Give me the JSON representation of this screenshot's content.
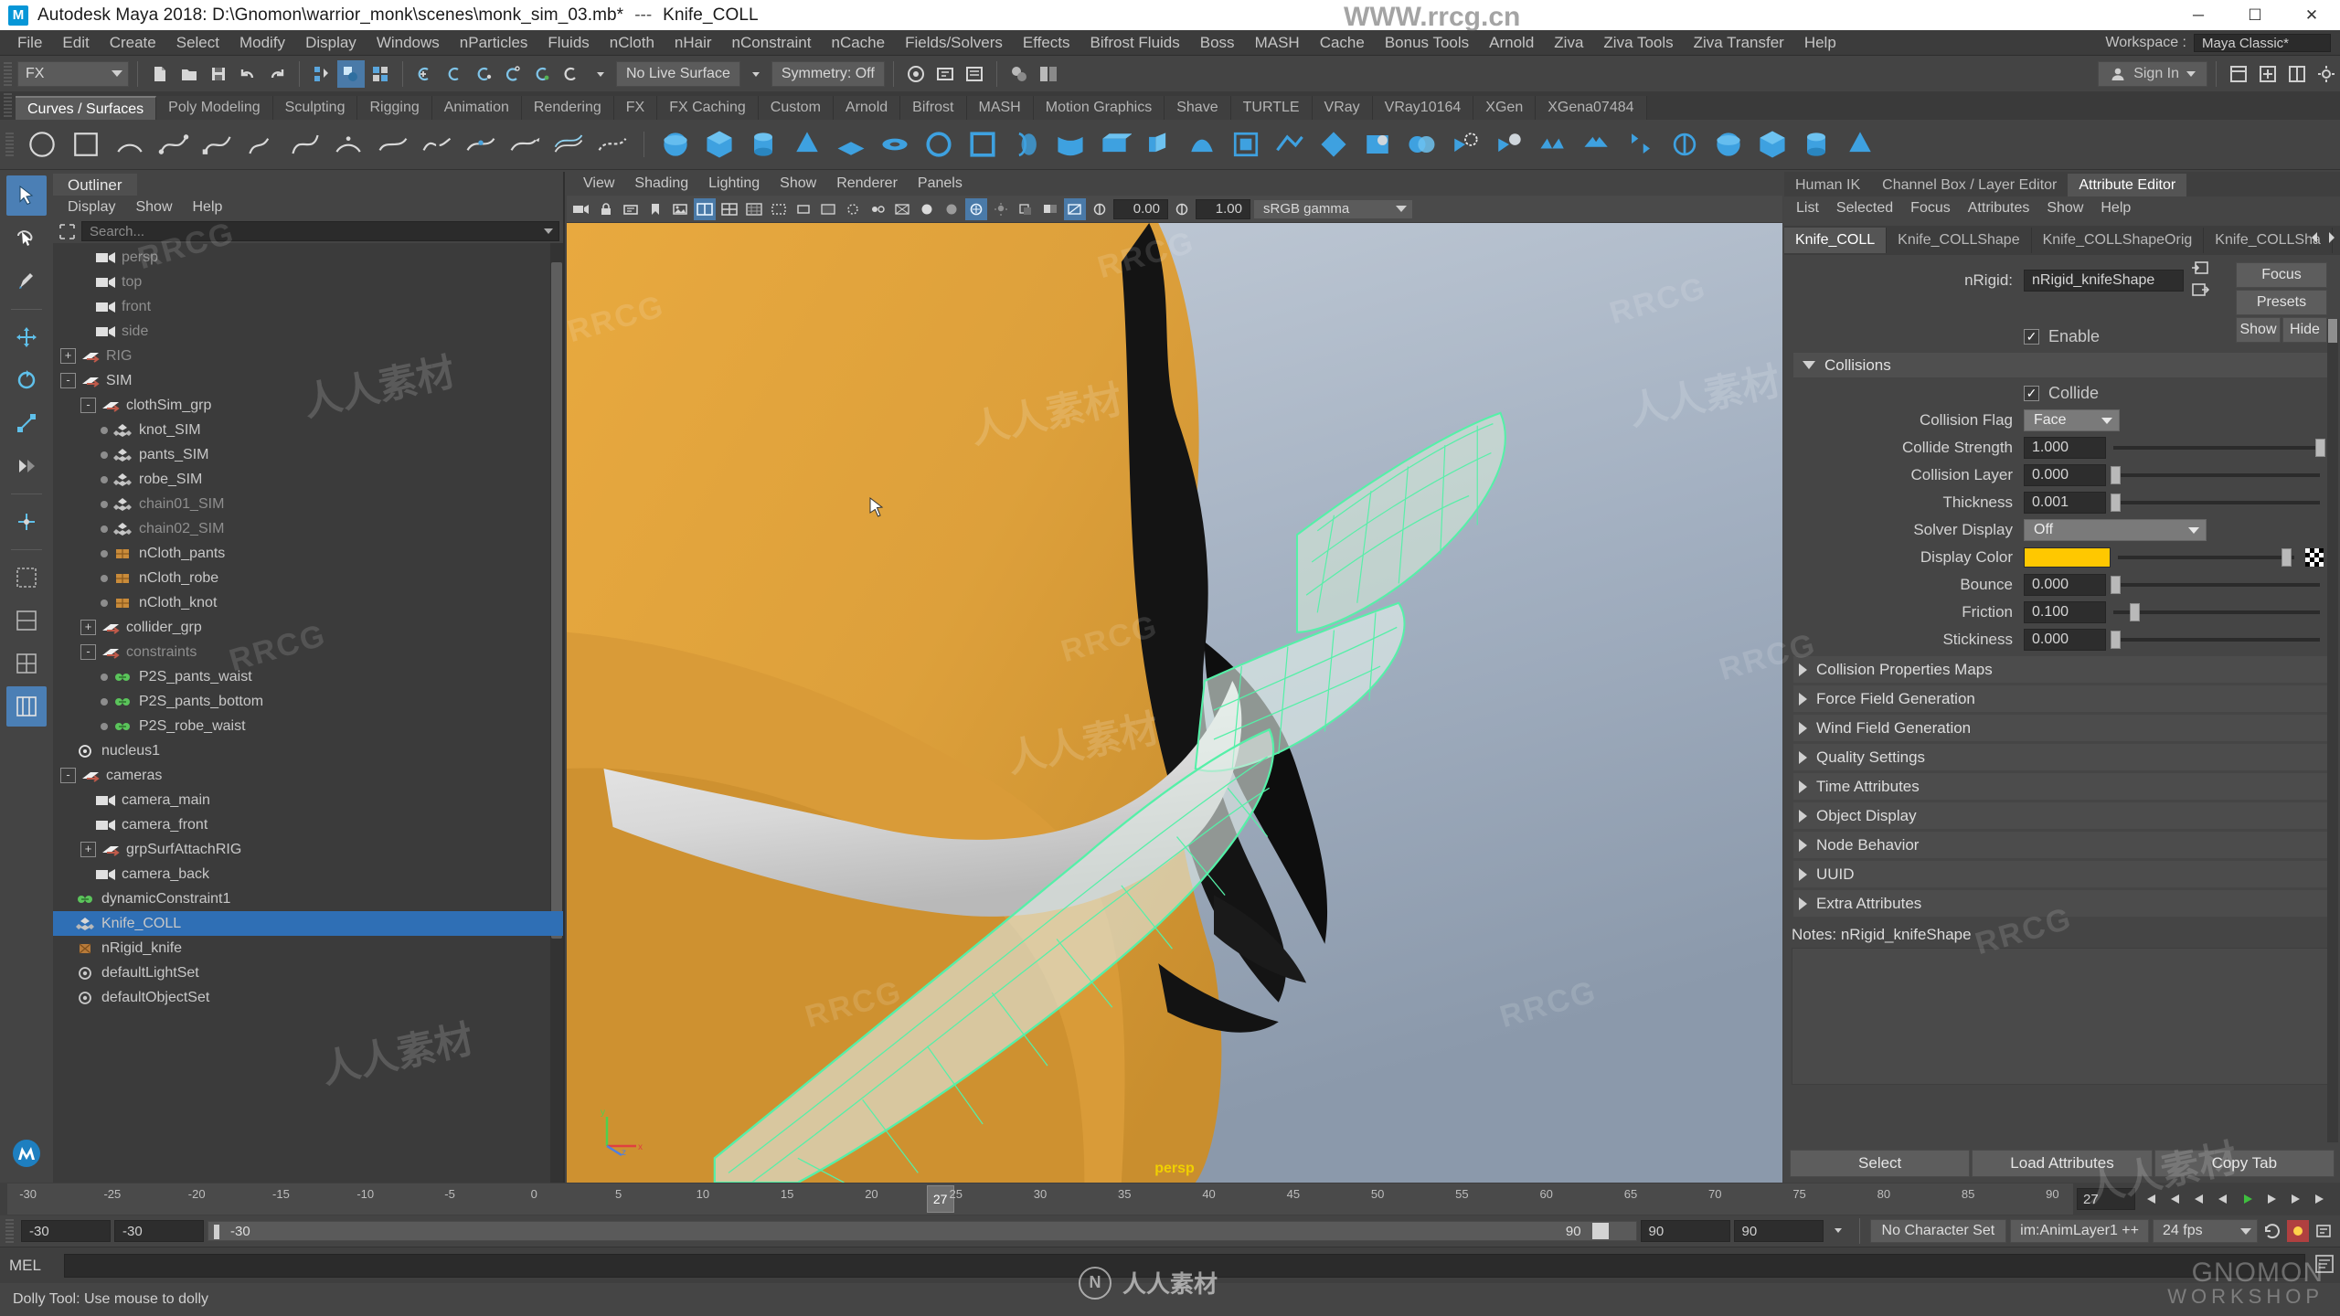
{
  "titlebar": {
    "logo": "M",
    "title": "Autodesk Maya 2018: D:\\Gnomon\\warrior_monk\\scenes\\monk_sim_03.mb*",
    "separator": "---",
    "object": "Knife_COLL",
    "minimize": "─",
    "maximize": "☐",
    "close": "✕"
  },
  "menubar": {
    "items": [
      "File",
      "Edit",
      "Create",
      "Select",
      "Modify",
      "Display",
      "Windows",
      "nParticles",
      "Fluids",
      "nCloth",
      "nHair",
      "nConstraint",
      "nCache",
      "Fields/Solvers",
      "Effects",
      "Bifrost Fluids",
      "Boss",
      "MASH",
      "Cache",
      "Bonus Tools",
      "Arnold",
      "Ziva",
      "Ziva Tools",
      "Ziva Transfer",
      "Help"
    ],
    "workspace_label": "Workspace :",
    "workspace_value": "Maya Classic*"
  },
  "statusline": {
    "mode": "FX",
    "live_surface": "No Live Surface",
    "symmetry": "Symmetry: Off",
    "signin": "Sign In",
    "icons": [
      "new-scene-icon",
      "open-scene-icon",
      "save-scene-icon",
      "undo-icon",
      "redo-icon",
      "select-by-hierarchy-icon",
      "select-by-object-icon",
      "select-by-component-icon",
      "snap-to-grid-icon",
      "snap-to-curve-icon",
      "snap-to-point-icon",
      "snap-to-projected-center-icon",
      "snap-to-view-plane-icon",
      "make-live-icon",
      "render-current-frame-icon",
      "ipr-render-icon",
      "render-settings-icon",
      "hypershade-icon",
      "show-hide-editors-icon"
    ]
  },
  "shelf": {
    "tabs": [
      "Curves / Surfaces",
      "Poly Modeling",
      "Sculpting",
      "Rigging",
      "Animation",
      "Rendering",
      "FX",
      "FX Caching",
      "Custom",
      "Arnold",
      "Bifrost",
      "MASH",
      "Motion Graphics",
      "Shave",
      "TURTLE",
      "VRay",
      "VRay10164",
      "XGen",
      "XGena07484"
    ],
    "active_tab": "Curves / Surfaces",
    "icons": [
      "nurbs-circle-icon",
      "nurbs-square-icon",
      "nurbs-arc-icon",
      "ep-curve-icon",
      "cv-curve-icon",
      "pencil-curve-icon",
      "bezier-curve-icon",
      "three-point-arc-icon",
      "attach-curve-icon",
      "detach-curve-icon",
      "insert-knot-icon",
      "extend-curve-icon",
      "offset-curve-icon",
      "rebuild-curve-icon",
      "sphere-icon",
      "cube-icon",
      "cylinder-icon",
      "cone-icon",
      "plane-icon",
      "torus-icon",
      "circle-prim-icon",
      "square-prim-icon",
      "revolve-icon",
      "loft-icon",
      "planar-icon",
      "extrude-icon",
      "birail-icon",
      "boundary-icon",
      "square-surface-icon",
      "bevel-icon",
      "bevel-plus-icon",
      "intersect-icon",
      "project-curve-icon",
      "trim-icon",
      "untrim-icon",
      "booleans-union-icon",
      "booleans-subtract-icon",
      "attach-surfaces-icon",
      "detach-surfaces-icon",
      "align-surfaces-icon",
      "sculpt-geometry-icon",
      "surface-editing-icon"
    ]
  },
  "toolbox": {
    "tools": [
      "select-tool",
      "lasso-select-tool",
      "paint-select-tool",
      "move-tool",
      "rotate-tool",
      "scale-tool",
      "last-tool-used",
      "show-manipulator-tool",
      "four-view-layout",
      "persp-outliner-layout",
      "persp-graph-layout",
      "hypershade-persp-layout"
    ]
  },
  "outliner": {
    "tab": "Outliner",
    "menus": [
      "Display",
      "Show",
      "Help"
    ],
    "search_placeholder": "Search...",
    "tree": [
      {
        "label": "persp",
        "depth": 1,
        "icon": "camera-icon",
        "expander": "",
        "dim": true
      },
      {
        "label": "top",
        "depth": 1,
        "icon": "camera-icon",
        "expander": "",
        "dim": true
      },
      {
        "label": "front",
        "depth": 1,
        "icon": "camera-icon",
        "expander": "",
        "dim": true
      },
      {
        "label": "side",
        "depth": 1,
        "icon": "camera-icon",
        "expander": "",
        "dim": true
      },
      {
        "label": "RIG",
        "depth": 0,
        "icon": "transform-icon",
        "expander": "+",
        "dim": true
      },
      {
        "label": "SIM",
        "depth": 0,
        "icon": "transform-icon",
        "expander": "-",
        "dim": false
      },
      {
        "label": "clothSim_grp",
        "depth": 1,
        "icon": "transform-icon",
        "expander": "-",
        "dim": false
      },
      {
        "label": "knot_SIM",
        "depth": 2,
        "icon": "mesh-icon",
        "expander": "",
        "dim": false
      },
      {
        "label": "pants_SIM",
        "depth": 2,
        "icon": "mesh-icon",
        "expander": "",
        "dim": false
      },
      {
        "label": "robe_SIM",
        "depth": 2,
        "icon": "mesh-icon",
        "expander": "",
        "dim": false
      },
      {
        "label": "chain01_SIM",
        "depth": 2,
        "icon": "mesh-icon",
        "expander": "",
        "dim": true
      },
      {
        "label": "chain02_SIM",
        "depth": 2,
        "icon": "mesh-icon",
        "expander": "",
        "dim": true
      },
      {
        "label": "nCloth_pants",
        "depth": 2,
        "icon": "ncloth-icon",
        "expander": "",
        "dim": false
      },
      {
        "label": "nCloth_robe",
        "depth": 2,
        "icon": "ncloth-icon",
        "expander": "",
        "dim": false
      },
      {
        "label": "nCloth_knot",
        "depth": 2,
        "icon": "ncloth-icon",
        "expander": "",
        "dim": false
      },
      {
        "label": "collider_grp",
        "depth": 1,
        "icon": "transform-icon",
        "expander": "+",
        "dim": false
      },
      {
        "label": "constraints",
        "depth": 1,
        "icon": "transform-icon",
        "expander": "-",
        "dim": true
      },
      {
        "label": "P2S_pants_waist",
        "depth": 2,
        "icon": "constraint-icon",
        "expander": "",
        "dim": false
      },
      {
        "label": "P2S_pants_bottom",
        "depth": 2,
        "icon": "constraint-icon",
        "expander": "",
        "dim": false
      },
      {
        "label": "P2S_robe_waist",
        "depth": 2,
        "icon": "constraint-icon",
        "expander": "",
        "dim": false
      },
      {
        "label": "nucleus1",
        "depth": 0,
        "icon": "nucleus-icon",
        "expander": "",
        "dim": false
      },
      {
        "label": "cameras",
        "depth": 0,
        "icon": "transform-icon",
        "expander": "-",
        "dim": false
      },
      {
        "label": "camera_main",
        "depth": 1,
        "icon": "camera-icon",
        "expander": "",
        "dim": false
      },
      {
        "label": "camera_front",
        "depth": 1,
        "icon": "camera-icon",
        "expander": "",
        "dim": false
      },
      {
        "label": "grpSurfAttachRIG",
        "depth": 1,
        "icon": "transform-icon",
        "expander": "+",
        "dim": false
      },
      {
        "label": "camera_back",
        "depth": 1,
        "icon": "camera-icon",
        "expander": "",
        "dim": false
      },
      {
        "label": "dynamicConstraint1",
        "depth": 0,
        "icon": "constraint-icon",
        "expander": "",
        "dim": false
      },
      {
        "label": "Knife_COLL",
        "depth": 0,
        "icon": "mesh-icon",
        "expander": "",
        "dim": false,
        "selected": true
      },
      {
        "label": "nRigid_knife",
        "depth": 0,
        "icon": "nrigid-icon",
        "expander": "",
        "dim": false
      },
      {
        "label": "defaultLightSet",
        "depth": 0,
        "icon": "set-icon",
        "expander": "",
        "dim": false
      },
      {
        "label": "defaultObjectSet",
        "depth": 0,
        "icon": "set-icon",
        "expander": "",
        "dim": false
      }
    ]
  },
  "viewport": {
    "menus": [
      "View",
      "Shading",
      "Lighting",
      "Show",
      "Renderer",
      "Panels"
    ],
    "exposure": "0.00",
    "gamma_value": "1.00",
    "color_mgmt": "sRGB gamma",
    "camera_label": "persp",
    "toolbar_icons": [
      "select-camera-icon",
      "lock-camera-icon",
      "camera-attributes-icon",
      "bookmark-icon",
      "image-plane-icon",
      "twopane-layout-icon",
      "fourpane-layout-icon",
      "grid-toggle-icon",
      "film-gate-icon",
      "resolution-gate-icon",
      "gate-mask-icon",
      "xray-toggle-icon",
      "xray-joints-icon",
      "wireframe-icon",
      "smooth-shade-icon",
      "flat-shade-icon",
      "textured-icon",
      "lights-icon",
      "shadows-icon",
      "ao-icon",
      "motion-blur-icon",
      "aa-icon",
      "isolate-select-icon",
      "grid-icon",
      "exposure-icon",
      "gamma-icon"
    ]
  },
  "attribute_editor": {
    "tabs": [
      "Human IK",
      "Channel Box / Layer Editor",
      "Attribute Editor"
    ],
    "active_tab": "Attribute Editor",
    "menus": [
      "List",
      "Selected",
      "Focus",
      "Attributes",
      "Show",
      "Help"
    ],
    "node_tabs": [
      "Knife_COLL",
      "Knife_COLLShape",
      "Knife_COLLShapeOrig",
      "Knife_COLLSha"
    ],
    "active_node_tab": "Knife_COLL",
    "nrigid_label": "nRigid:",
    "nrigid_value": "nRigid_knifeShape",
    "buttons": {
      "focus": "Focus",
      "presets": "Presets",
      "show": "Show",
      "hide": "Hide"
    },
    "enable_label": "Enable",
    "enable_checked": true,
    "collisions_section": "Collisions",
    "collide_label": "Collide",
    "collide_checked": true,
    "attributes": [
      {
        "label": "Collision Flag",
        "type": "combo",
        "value": "Face"
      },
      {
        "label": "Collide Strength",
        "type": "slider",
        "value": "1.000",
        "pct": 100
      },
      {
        "label": "Collision Layer",
        "type": "slider",
        "value": "0.000",
        "pct": 1
      },
      {
        "label": "Thickness",
        "type": "slider",
        "value": "0.001",
        "pct": 1
      },
      {
        "label": "Solver Display",
        "type": "combo-wide",
        "value": "Off"
      },
      {
        "label": "Display Color",
        "type": "color",
        "value": "#ffc800",
        "pct": 93
      },
      {
        "label": "Bounce",
        "type": "slider",
        "value": "0.000",
        "pct": 1
      },
      {
        "label": "Friction",
        "type": "slider",
        "value": "0.100",
        "pct": 10
      },
      {
        "label": "Stickiness",
        "type": "slider",
        "value": "0.000",
        "pct": 1
      }
    ],
    "collapsed_sections": [
      "Collision Properties Maps",
      "Force Field Generation",
      "Wind Field Generation",
      "Quality Settings",
      "Time Attributes",
      "Object Display",
      "Node Behavior",
      "UUID",
      "Extra Attributes"
    ],
    "notes_label": "Notes: nRigid_knifeShape",
    "footer_buttons": [
      "Select",
      "Load Attributes",
      "Copy Tab"
    ],
    "accent_color": "#ffc800"
  },
  "timeline": {
    "ticks": [
      "-30",
      "-25",
      "-20",
      "-15",
      "-10",
      "-5",
      "0",
      "5",
      "10",
      "15",
      "20",
      "25",
      "30",
      "35",
      "40",
      "45",
      "50",
      "55",
      "60",
      "65",
      "70",
      "75",
      "80",
      "85",
      "90"
    ],
    "current_frame": "27",
    "current_field": "27",
    "playback_icons": [
      "go-to-start-icon",
      "step-back-key-icon",
      "step-back-frame-icon",
      "play-backwards-icon",
      "play-forwards-icon",
      "step-forward-frame-icon",
      "step-forward-key-icon",
      "go-to-end-icon"
    ]
  },
  "rangeslider": {
    "anim_start": "-30",
    "range_start": "-30",
    "bar_value": "-30",
    "range_end": "90",
    "anim_end_1": "90",
    "anim_end_2": "90",
    "character_set": "No Character Set",
    "anim_layer": "im:AnimLayer1 ++",
    "fps": "24 fps"
  },
  "commandline": {
    "label": "MEL",
    "value": ""
  },
  "helpline": {
    "text": "Dolly Tool: Use mouse to dolly"
  },
  "watermarks": {
    "site": "WWW.rrcg.cn",
    "rrcg": "RRCG",
    "cn_text": "人人素材",
    "bottom_logo": "人人素材",
    "gnomon_1": "GNOMON",
    "gnomon_2": "WORKSHOP"
  }
}
